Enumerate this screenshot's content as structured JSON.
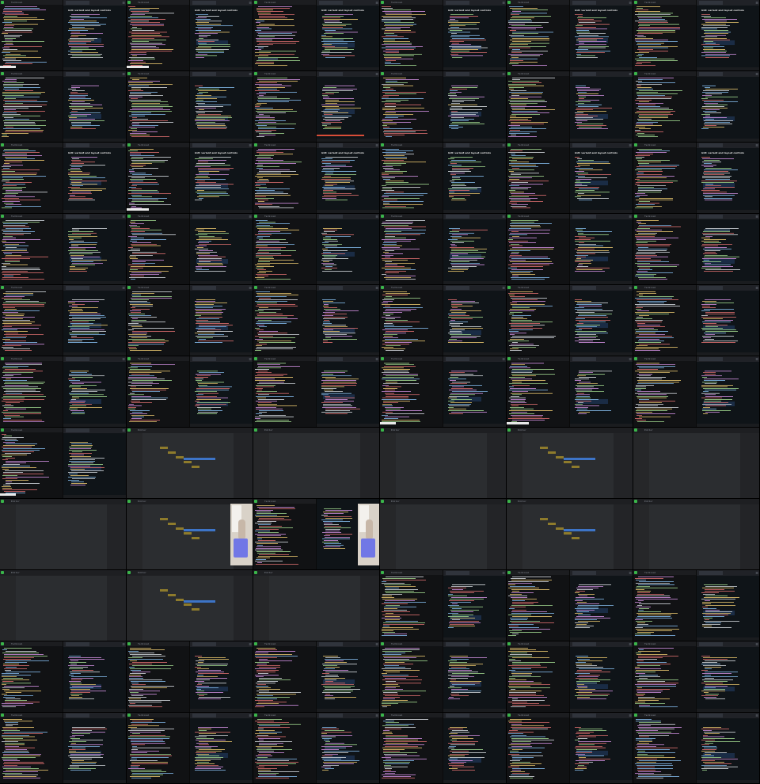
{
  "sheet": {
    "rows": 11,
    "cols": 6,
    "frames": [
      {
        "kind": "term-browser",
        "title": "Terminal",
        "browser_heading": "GUI: variant and layout controls",
        "bar": "white"
      },
      {
        "kind": "term-browser",
        "title": "Terminal",
        "browser_heading": "GUI: variant and layout controls",
        "bar": "white"
      },
      {
        "kind": "term-browser",
        "title": "Terminal",
        "browser_heading": "GUI: variant and layout controls"
      },
      {
        "kind": "term-browser",
        "title": "Terminal",
        "browser_heading": "GUI: variant and layout controls"
      },
      {
        "kind": "term-browser",
        "title": "Terminal",
        "browser_heading": "GUI: variant and layout controls"
      },
      {
        "kind": "term-browser",
        "title": "Terminal",
        "browser_heading": "GUI: variant and layout controls"
      },
      {
        "kind": "term-browser",
        "title": "Terminal",
        "browser_heading": ""
      },
      {
        "kind": "term-browser",
        "title": "Terminal",
        "browser_heading": ""
      },
      {
        "kind": "term-browser",
        "title": "Terminal",
        "browser_heading": "",
        "bar": "red"
      },
      {
        "kind": "term-browser",
        "title": "Terminal",
        "browser_heading": ""
      },
      {
        "kind": "term-browser",
        "title": "Terminal",
        "browser_heading": ""
      },
      {
        "kind": "term-browser",
        "title": "Terminal",
        "browser_heading": ""
      },
      {
        "kind": "term-browser",
        "title": "Terminal",
        "browser_heading": "GUI: variant and layout controls"
      },
      {
        "kind": "term-browser",
        "title": "Terminal",
        "browser_heading": "GUI: variant and layout controls",
        "bar": "white"
      },
      {
        "kind": "term-browser",
        "title": "Terminal",
        "browser_heading": "GUI: variant and layout controls"
      },
      {
        "kind": "term-browser",
        "title": "Terminal",
        "browser_heading": "GUI: variant and layout controls"
      },
      {
        "kind": "term-browser",
        "title": "Terminal",
        "browser_heading": "GUI: variant and layout controls"
      },
      {
        "kind": "term-browser",
        "title": "Terminal",
        "browser_heading": "GUI: variant and layout controls"
      },
      {
        "kind": "term-browser",
        "title": "Terminal",
        "browser_heading": ""
      },
      {
        "kind": "term-browser",
        "title": "Terminal",
        "browser_heading": ""
      },
      {
        "kind": "term-browser",
        "title": "Terminal",
        "browser_heading": ""
      },
      {
        "kind": "term-browser",
        "title": "Terminal",
        "browser_heading": ""
      },
      {
        "kind": "term-browser",
        "title": "Terminal",
        "browser_heading": ""
      },
      {
        "kind": "term-browser",
        "title": "Terminal",
        "browser_heading": ""
      },
      {
        "kind": "term-browser",
        "title": "Terminal",
        "browser_heading": ""
      },
      {
        "kind": "term-browser",
        "title": "Terminal",
        "browser_heading": ""
      },
      {
        "kind": "term-browser",
        "title": "Terminal",
        "browser_heading": ""
      },
      {
        "kind": "term-browser",
        "title": "Terminal",
        "browser_heading": ""
      },
      {
        "kind": "term-browser",
        "title": "Terminal",
        "browser_heading": ""
      },
      {
        "kind": "term-browser",
        "title": "Terminal",
        "browser_heading": ""
      },
      {
        "kind": "term-browser",
        "title": "Terminal",
        "browser_heading": ""
      },
      {
        "kind": "term-browser",
        "title": "Terminal",
        "browser_heading": ""
      },
      {
        "kind": "term-browser",
        "title": "Terminal",
        "browser_heading": ""
      },
      {
        "kind": "term-browser",
        "title": "Terminal",
        "browser_heading": "",
        "bar": "white"
      },
      {
        "kind": "term-browser",
        "title": "Terminal",
        "browser_heading": "",
        "bar": "white"
      },
      {
        "kind": "term-browser",
        "title": "Terminal",
        "browser_heading": ""
      },
      {
        "kind": "term-browser",
        "title": "Terminal",
        "browser_heading": "",
        "bar": "white"
      },
      {
        "kind": "ide",
        "title": "Editor"
      },
      {
        "kind": "ide",
        "title": "Editor"
      },
      {
        "kind": "ide",
        "title": "Editor"
      },
      {
        "kind": "ide",
        "title": "Editor"
      },
      {
        "kind": "ide",
        "title": "Editor"
      },
      {
        "kind": "ide",
        "title": "Editor"
      },
      {
        "kind": "ide-webcam",
        "title": "Editor"
      },
      {
        "kind": "term-webcam",
        "title": "Terminal"
      },
      {
        "kind": "ide",
        "title": "Editor"
      },
      {
        "kind": "ide",
        "title": "Editor"
      },
      {
        "kind": "ide",
        "title": "Editor"
      },
      {
        "kind": "ide",
        "title": "Editor"
      },
      {
        "kind": "ide",
        "title": "Editor"
      },
      {
        "kind": "ide",
        "title": "Editor"
      },
      {
        "kind": "term-browser",
        "title": "Terminal",
        "browser_heading": ""
      },
      {
        "kind": "term-browser",
        "title": "Terminal",
        "browser_heading": ""
      },
      {
        "kind": "term-browser",
        "title": "Terminal",
        "browser_heading": ""
      },
      {
        "kind": "term-browser",
        "title": "Terminal",
        "browser_heading": ""
      },
      {
        "kind": "term-browser",
        "title": "Terminal",
        "browser_heading": ""
      },
      {
        "kind": "term-browser",
        "title": "Terminal",
        "browser_heading": ""
      },
      {
        "kind": "term-browser",
        "title": "Terminal",
        "browser_heading": ""
      },
      {
        "kind": "term-browser",
        "title": "Terminal",
        "browser_heading": ""
      },
      {
        "kind": "term-browser",
        "title": "Terminal",
        "browser_heading": ""
      },
      {
        "kind": "term-browser",
        "title": "Terminal",
        "browser_heading": ""
      },
      {
        "kind": "term-browser",
        "title": "Terminal",
        "browser_heading": ""
      },
      {
        "kind": "term-browser",
        "title": "Terminal",
        "browser_heading": ""
      },
      {
        "kind": "term-browser",
        "title": "Terminal",
        "browser_heading": ""
      },
      {
        "kind": "term-browser",
        "title": "Terminal",
        "browser_heading": ""
      },
      {
        "kind": "term-browser",
        "title": "Terminal",
        "browser_heading": ""
      }
    ]
  },
  "colors": {
    "terminal_bg": "#111214",
    "browser_bg": "#0f1418",
    "ide_bg": "#2b2d30",
    "status_dot": "#3ab54a",
    "code_colors": [
      "#d56b6b",
      "#7fb4e3",
      "#e0c06b",
      "#9bd08a",
      "#c98bd8",
      "#cfd3d8"
    ]
  },
  "icons": [
    "traffic-light-icon",
    "tab-icon",
    "menu-icon"
  ]
}
